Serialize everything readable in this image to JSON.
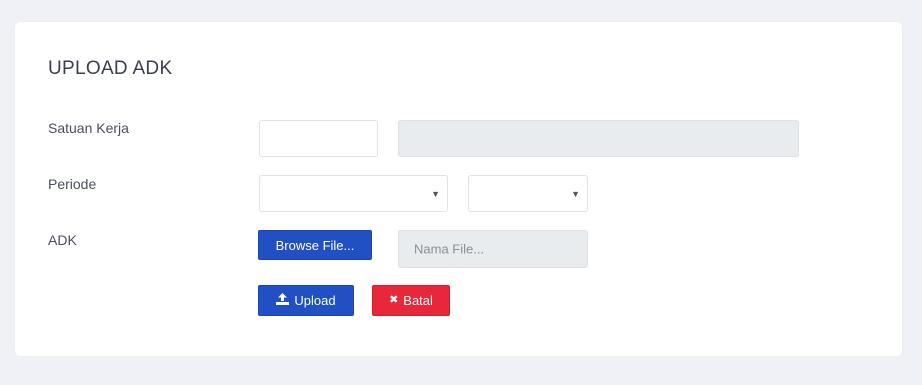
{
  "form": {
    "title": "UPLOAD ADK",
    "satker": {
      "label": "Satuan Kerja",
      "code_value": "",
      "name_value": ""
    },
    "periode": {
      "label": "Periode",
      "first_value": "",
      "second_value": ""
    },
    "adk": {
      "label": "ADK",
      "browse_label": "Browse File...",
      "filename_placeholder": "Nama File..."
    },
    "actions": {
      "upload_label": "Upload",
      "cancel_label": "Batal"
    }
  },
  "colors": {
    "primary": "#2150c5",
    "danger": "#e8273a",
    "page_bg": "#f0f1f6"
  },
  "icons": {
    "upload": "upload-icon",
    "cancel": "close-icon",
    "dropdown": "caret-down-icon"
  }
}
